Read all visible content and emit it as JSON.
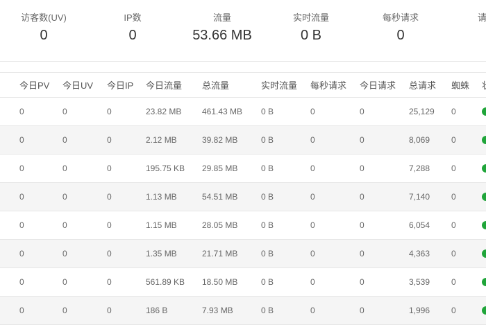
{
  "stats": [
    {
      "label": "访客数(UV)",
      "value": "0"
    },
    {
      "label": "IP数",
      "value": "0"
    },
    {
      "label": "流量",
      "value": "53.66 MB"
    },
    {
      "label": "实时流量",
      "value": "0 B"
    },
    {
      "label": "每秒请求",
      "value": "0"
    },
    {
      "label": "请",
      "value": ""
    }
  ],
  "table": {
    "headers": [
      "今日PV",
      "今日UV",
      "今日IP",
      "今日流量",
      "总流量",
      "实时流量",
      "每秒请求",
      "今日请求",
      "总请求",
      "蜘蛛",
      "状"
    ],
    "rows": [
      [
        "0",
        "0",
        "0",
        "23.82 MB",
        "461.43 MB",
        "0 B",
        "0",
        "0",
        "25,129",
        "0"
      ],
      [
        "0",
        "0",
        "0",
        "2.12 MB",
        "39.82 MB",
        "0 B",
        "0",
        "0",
        "8,069",
        "0"
      ],
      [
        "0",
        "0",
        "0",
        "195.75 KB",
        "29.85 MB",
        "0 B",
        "0",
        "0",
        "7,288",
        "0"
      ],
      [
        "0",
        "0",
        "0",
        "1.13 MB",
        "54.51 MB",
        "0 B",
        "0",
        "0",
        "7,140",
        "0"
      ],
      [
        "0",
        "0",
        "0",
        "1.15 MB",
        "28.05 MB",
        "0 B",
        "0",
        "0",
        "6,054",
        "0"
      ],
      [
        "0",
        "0",
        "0",
        "1.35 MB",
        "21.71 MB",
        "0 B",
        "0",
        "0",
        "4,363",
        "0"
      ],
      [
        "0",
        "0",
        "0",
        "561.89 KB",
        "18.50 MB",
        "0 B",
        "0",
        "0",
        "3,539",
        "0"
      ],
      [
        "0",
        "0",
        "0",
        "186 B",
        "7.93 MB",
        "0 B",
        "0",
        "0",
        "1,996",
        "0"
      ]
    ],
    "status_color": "#20a53a"
  }
}
